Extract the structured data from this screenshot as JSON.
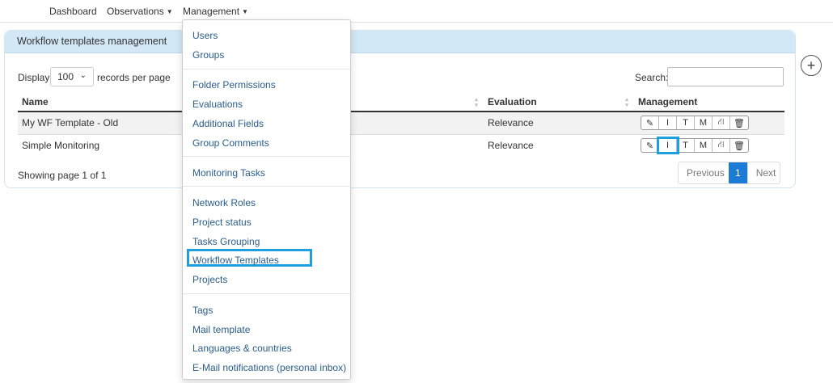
{
  "nav": {
    "items": [
      {
        "label": "Dashboard"
      },
      {
        "label": "Observations"
      },
      {
        "label": "Management"
      }
    ]
  },
  "panel": {
    "title": "Workflow templates management",
    "display_label": "Display",
    "page_size": "100",
    "records_label": "records per page",
    "search_label": "Search:",
    "search_value": ""
  },
  "table": {
    "headers": [
      "Name",
      "",
      "Evaluation",
      "Management"
    ],
    "rows": [
      {
        "name": "My WF Template - Old",
        "evaluation": "Relevance"
      },
      {
        "name": "Simple Monitoring",
        "evaluation": "Relevance"
      }
    ],
    "mgmt_icons": [
      "pencil-icon",
      "text-cursor-icon",
      "text-icon",
      "letter-m-icon",
      "workflow-icon",
      "trash-icon"
    ],
    "mgmt_glyphs": [
      "✎",
      "I",
      "T",
      "M",
      "⛙",
      "🗑"
    ]
  },
  "footer": {
    "showing": "Showing page 1 of 1",
    "previous": "Previous",
    "current_page": "1",
    "next": "Next"
  },
  "add_button": "+",
  "dropdown": {
    "groups": [
      [
        "Users",
        "Groups"
      ],
      [
        "Folder Permissions",
        "Evaluations",
        "Additional Fields",
        "Group Comments"
      ],
      [
        "Monitoring Tasks"
      ],
      [
        "Network Roles",
        "Project status",
        "Tasks Grouping",
        "Workflow Templates",
        "Projects"
      ],
      [
        "Tags",
        "Mail template",
        "Languages & countries",
        "E-Mail notifications (personal inbox)"
      ]
    ],
    "highlighted": "Workflow Templates"
  },
  "colors": {
    "accent": "#1ea0e0",
    "panel_header": "#d2e8f6",
    "pager_active": "#1c7cd5",
    "link": "#2a5c8a"
  }
}
